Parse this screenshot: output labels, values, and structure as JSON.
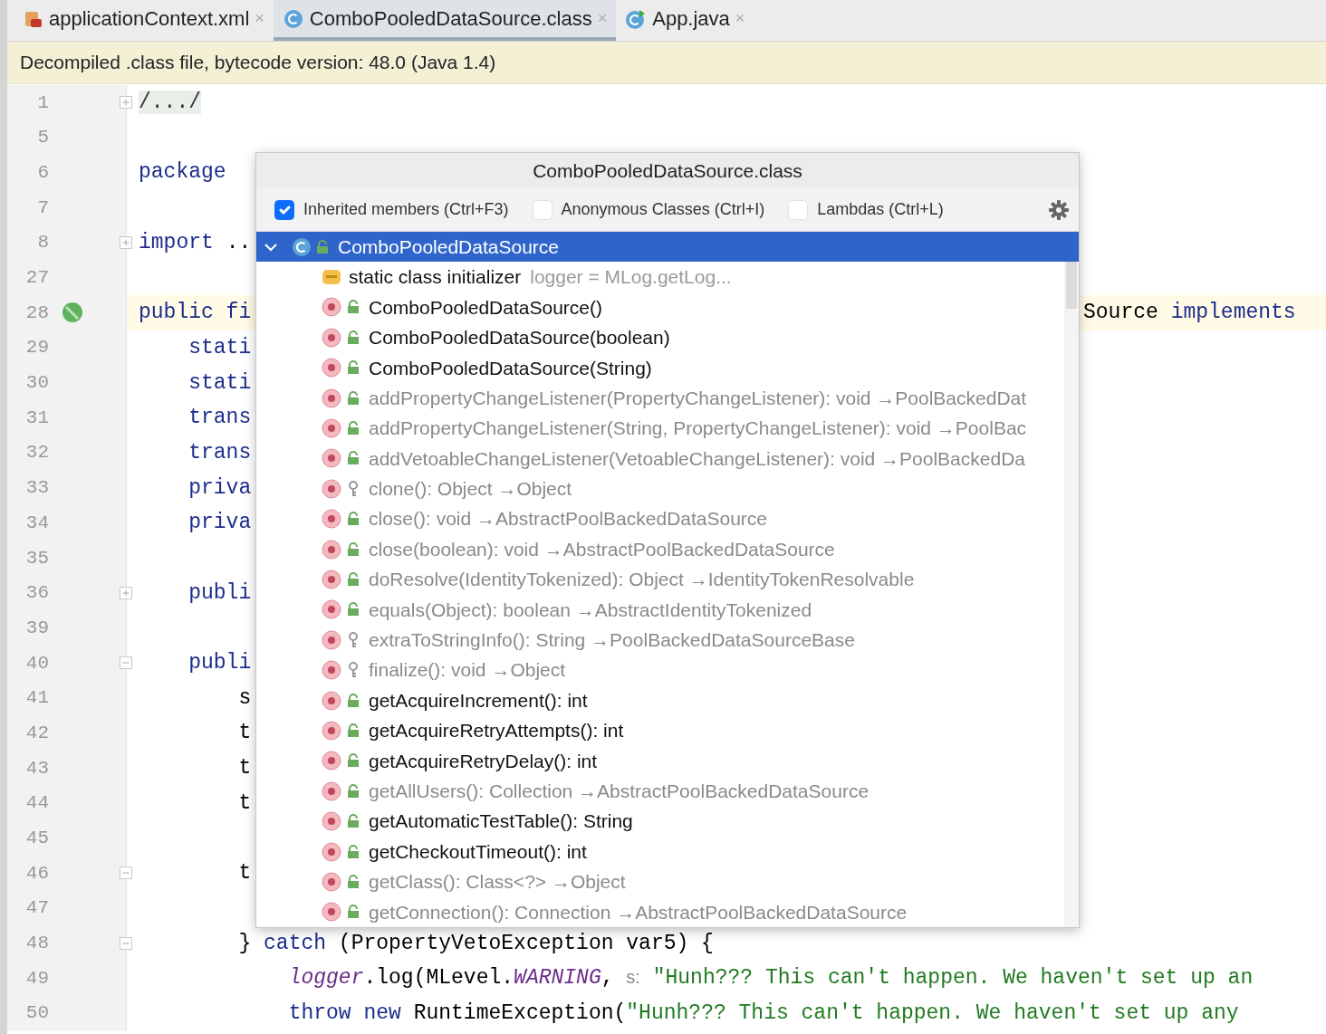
{
  "tabs": [
    {
      "label": "applicationContext.xml",
      "selected": false,
      "close": "×"
    },
    {
      "label": "ComboPooledDataSource.class",
      "selected": true,
      "close": "×"
    },
    {
      "label": "App.java",
      "selected": false,
      "close": "×"
    }
  ],
  "banner": "Decompiled .class file, bytecode version: 48.0 (Java 1.4)",
  "code_lines": [
    {
      "number": "1",
      "collapsed": true,
      "parts": [
        {
          "text": "/.../",
          "kind": "folded"
        }
      ]
    },
    {
      "number": "5"
    },
    {
      "number": "6",
      "parts": [
        {
          "text": "package",
          "kind": "keyword"
        }
      ]
    },
    {
      "number": "7"
    },
    {
      "number": "8",
      "collapsed": true,
      "parts": [
        {
          "text": "import",
          "kind": "keyword"
        },
        {
          "text": " ..",
          "kind": "plain"
        }
      ]
    },
    {
      "number": "27"
    },
    {
      "number": "28",
      "current": true,
      "gutter_icon": true,
      "parts": [
        {
          "text": "public fi",
          "kind": "keyword"
        }
      ],
      "right_parts": [
        {
          "text": "Source ",
          "kind": "plain"
        },
        {
          "text": "implements",
          "kind": "keyword"
        }
      ]
    },
    {
      "number": "29",
      "parts": [
        {
          "text": "    stati",
          "kind": "keyword"
        }
      ]
    },
    {
      "number": "30",
      "parts": [
        {
          "text": "    stati",
          "kind": "keyword"
        }
      ]
    },
    {
      "number": "31",
      "parts": [
        {
          "text": "    trans",
          "kind": "keyword"
        }
      ]
    },
    {
      "number": "32",
      "parts": [
        {
          "text": "    trans",
          "kind": "keyword"
        }
      ]
    },
    {
      "number": "33",
      "parts": [
        {
          "text": "    priva",
          "kind": "keyword"
        }
      ]
    },
    {
      "number": "34",
      "parts": [
        {
          "text": "    priva",
          "kind": "keyword"
        }
      ]
    },
    {
      "number": "35"
    },
    {
      "number": "36",
      "collapsed": true,
      "parts": [
        {
          "text": "    publi",
          "kind": "keyword"
        }
      ]
    },
    {
      "number": "39"
    },
    {
      "number": "40",
      "collapsed": false,
      "parts": [
        {
          "text": "    publi",
          "kind": "keyword"
        }
      ]
    },
    {
      "number": "41",
      "parts": [
        {
          "text": "        s",
          "kind": "plain"
        }
      ]
    },
    {
      "number": "42",
      "parts": [
        {
          "text": "        t",
          "kind": "plain"
        }
      ]
    },
    {
      "number": "43",
      "parts": [
        {
          "text": "        t",
          "kind": "plain"
        }
      ]
    },
    {
      "number": "44",
      "parts": [
        {
          "text": "        t",
          "kind": "plain"
        }
      ]
    },
    {
      "number": "45"
    },
    {
      "number": "46",
      "collapsed": false,
      "parts": [
        {
          "text": "        t",
          "kind": "plain"
        }
      ]
    },
    {
      "number": "47"
    },
    {
      "number": "48",
      "collapsed": false,
      "parts": [
        {
          "text": "        } ",
          "kind": "plain"
        },
        {
          "text": "catch",
          "kind": "keyword"
        },
        {
          "text": " (PropertyVetoException var5) {",
          "kind": "plain"
        }
      ]
    },
    {
      "number": "49",
      "parts": [
        {
          "text": "            logger",
          "kind": "field"
        },
        {
          "text": ".log(MLevel.",
          "kind": "plain"
        },
        {
          "text": "WARNING",
          "kind": "field"
        },
        {
          "text": ", ",
          "kind": "plain"
        },
        {
          "text": "s:",
          "kind": "hint"
        },
        {
          "text": " \"Hunh??? This can't happen. We haven't set up an",
          "kind": "string"
        }
      ]
    },
    {
      "number": "50",
      "parts": [
        {
          "text": "            throw new",
          "kind": "keyword"
        },
        {
          "text": " RuntimeException(",
          "kind": "plain"
        },
        {
          "text": "\"Hunh??? This can't happen. We haven't set up any",
          "kind": "string"
        }
      ]
    }
  ],
  "structure_popup": {
    "title": "ComboPooledDataSource.class",
    "options": [
      {
        "label": "Inherited members (Ctrl+F3)",
        "checked": true
      },
      {
        "label": "Anonymous Classes (Ctrl+I)",
        "checked": false
      },
      {
        "label": "Lambdas (Ctrl+L)",
        "checked": false
      }
    ],
    "tree": [
      {
        "label": "ComboPooledDataSource",
        "selected": true,
        "expanded": true,
        "children": [
          {
            "kind": "initializer",
            "label": "static class initializer",
            "detail": "logger = MLog.getLog...",
            "selected": false
          },
          {
            "kind": "method",
            "label": "ComboPooledDataSource()",
            "protected": false,
            "inherited": false,
            "selected": false
          },
          {
            "kind": "method",
            "label": "ComboPooledDataSource(boolean)",
            "protected": false,
            "inherited": false,
            "selected": false
          },
          {
            "kind": "method",
            "label": "ComboPooledDataSource(String)",
            "protected": false,
            "inherited": false,
            "selected": false
          },
          {
            "kind": "method",
            "label": "addPropertyChangeListener(PropertyChangeListener): void →PoolBackedDat",
            "protected": false,
            "inherited": true,
            "selected": false
          },
          {
            "kind": "method",
            "label": "addPropertyChangeListener(String, PropertyChangeListener): void →PoolBac",
            "protected": false,
            "inherited": true,
            "selected": false
          },
          {
            "kind": "method",
            "label": "addVetoableChangeListener(VetoableChangeListener): void →PoolBackedDa",
            "protected": false,
            "inherited": true,
            "selected": false
          },
          {
            "kind": "method",
            "label": "clone(): Object →Object",
            "protected": true,
            "inherited": true,
            "selected": false
          },
          {
            "kind": "method",
            "label": "close(): void →AbstractPoolBackedDataSource",
            "protected": false,
            "inherited": true,
            "selected": false
          },
          {
            "kind": "method",
            "label": "close(boolean): void →AbstractPoolBackedDataSource",
            "protected": false,
            "inherited": true,
            "selected": false
          },
          {
            "kind": "method",
            "label": "doResolve(IdentityTokenized): Object →IdentityTokenResolvable",
            "protected": false,
            "inherited": true,
            "selected": false
          },
          {
            "kind": "method",
            "label": "equals(Object): boolean →AbstractIdentityTokenized",
            "protected": false,
            "inherited": true,
            "selected": false
          },
          {
            "kind": "method",
            "label": "extraToStringInfo(): String →PoolBackedDataSourceBase",
            "protected": true,
            "inherited": true,
            "selected": false
          },
          {
            "kind": "method",
            "label": "finalize(): void →Object",
            "protected": true,
            "inherited": true,
            "selected": false
          },
          {
            "kind": "method",
            "label": "getAcquireIncrement(): int",
            "protected": false,
            "inherited": false,
            "selected": false
          },
          {
            "kind": "method",
            "label": "getAcquireRetryAttempts(): int",
            "protected": false,
            "inherited": false,
            "selected": false
          },
          {
            "kind": "method",
            "label": "getAcquireRetryDelay(): int",
            "protected": false,
            "inherited": false,
            "selected": false
          },
          {
            "kind": "method",
            "label": "getAllUsers(): Collection →AbstractPoolBackedDataSource",
            "protected": false,
            "inherited": true,
            "selected": false
          },
          {
            "kind": "method",
            "label": "getAutomaticTestTable(): String",
            "protected": false,
            "inherited": false,
            "selected": false
          },
          {
            "kind": "method",
            "label": "getCheckoutTimeout(): int",
            "protected": false,
            "inherited": false,
            "selected": false
          },
          {
            "kind": "method",
            "label": "getClass(): Class<?> →Object",
            "protected": false,
            "inherited": true,
            "selected": false
          },
          {
            "kind": "method",
            "label": "getConnection(): Connection →AbstractPoolBackedDataSource",
            "protected": false,
            "inherited": true,
            "selected": false
          }
        ]
      }
    ]
  }
}
